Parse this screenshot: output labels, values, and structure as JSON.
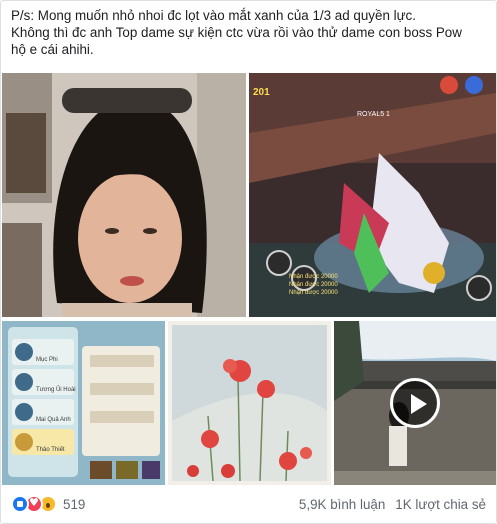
{
  "post": {
    "caption_lines": [
      "P/s: Mong muốn nhỏ nhoi đc lọt vào mắt xanh của 1/3 ad quyền lực.",
      "Không thì đc anh Top dame sự kiện ctc vừa rồi vào thử dame con boss Pow",
      "hộ e cái ahihi."
    ]
  },
  "photos": [
    {
      "icon": "selfie-photo"
    },
    {
      "icon": "game-screenshot-photo"
    },
    {
      "icon": "game-menu-photo"
    },
    {
      "icon": "flowers-photo"
    },
    {
      "icon": "video-thumbnail",
      "play_icon": "play-icon"
    }
  ],
  "game": {
    "top_left": "201",
    "score": "ROYAL5 1",
    "chat_lines": [
      "Nhận được 20000",
      "Nhận được 20000",
      "Nhận được 20000"
    ]
  },
  "menu": {
    "items": [
      "Mục Phi",
      "Tương Ủi Hoài",
      "Mai Quả Anh",
      "Thảo Thiết"
    ]
  },
  "footer": {
    "reactions": [
      "like-icon",
      "love-icon",
      "wow-icon"
    ],
    "reaction_count": "519",
    "comments": "5,9K bình luận",
    "shares": "1K lượt chia sẻ"
  },
  "colors": {
    "like": "#1877f2",
    "love": "#f33e58",
    "wow": "#f7b928",
    "meta_text": "#606770"
  }
}
